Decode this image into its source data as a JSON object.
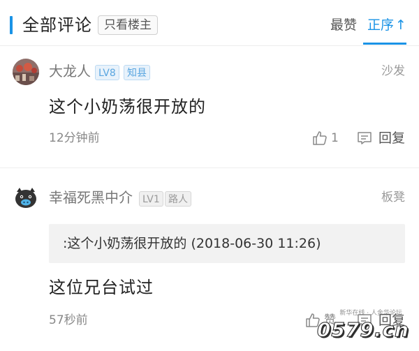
{
  "header": {
    "title": "全部评论",
    "owner_only_label": "只看楼主",
    "sort_hot_label": "最赞",
    "sort_asc_label": "正序",
    "sort_asc_arrow": "↑",
    "accent_color": "#1a93e6"
  },
  "comments": [
    {
      "username": "大龙人",
      "level": "LV8",
      "rank": "知县",
      "floor": "沙发",
      "content": "这个小奶荡很开放的",
      "time": "12分钟前",
      "like_count": "1",
      "reply_label": "回复",
      "avatar_icon": "user-photo-avatar"
    },
    {
      "username": "幸福死黑中介",
      "level": "LV1",
      "rank": "路人",
      "floor": "板凳",
      "quote": ":这个小奶荡很开放的 (2018-06-30 11:26)",
      "content": "这位兄台试过",
      "time": "57秒前",
      "like_label": "赞",
      "reply_label": "回复",
      "avatar_icon": "pig-avatar"
    }
  ],
  "watermark": {
    "small_text": "新华在线 · 人金华论坛",
    "logo_text": "0579.cn"
  }
}
